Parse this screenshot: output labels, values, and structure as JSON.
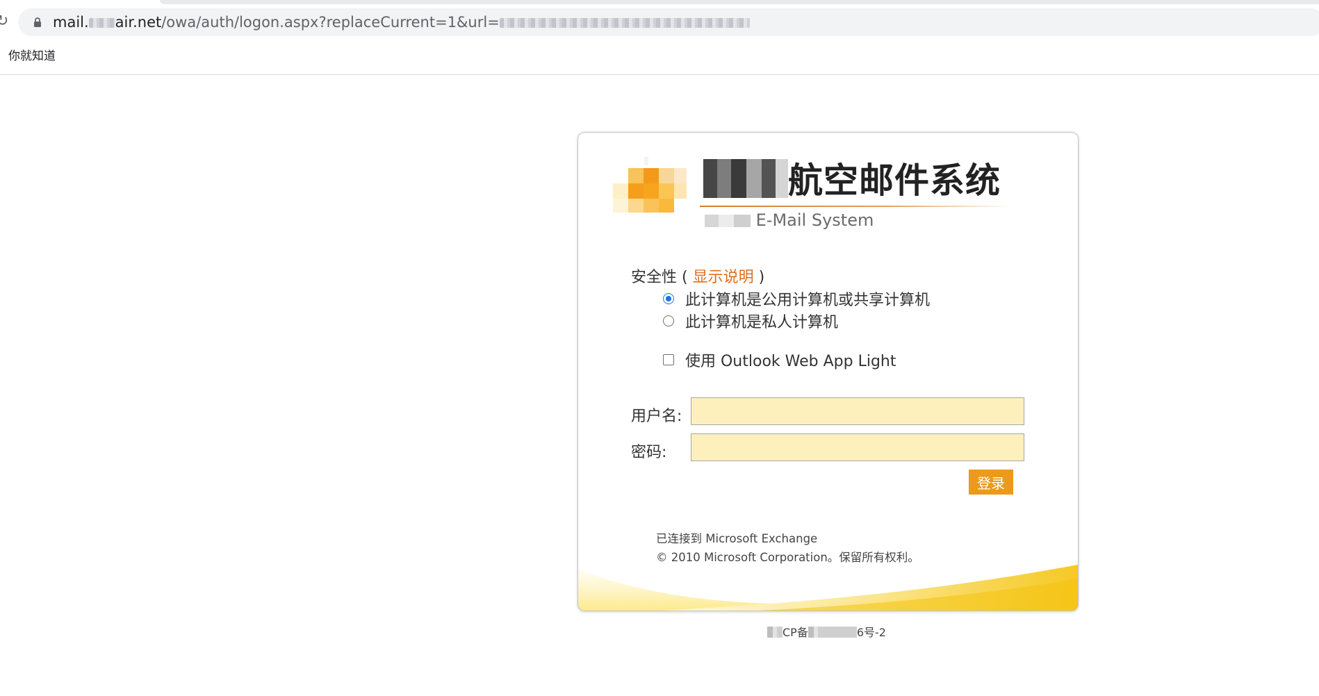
{
  "browser": {
    "url_host_prefix": "mail.",
    "url_host_suffix": "air.net",
    "url_path": "/owa/auth/logon.aspx?replaceCurrent=1&url=",
    "bookmark_label": "你就知道"
  },
  "logo": {
    "title_visible": "航空邮件系统",
    "subtitle": "E-Mail System"
  },
  "security": {
    "label_prefix": "安全性 (",
    "show_help_link": "显示说明",
    "label_suffix": ")"
  },
  "options": {
    "public_computer": "此计算机是公用计算机或共享计算机",
    "private_computer": "此计算机是私人计算机",
    "light_version": "使用 Outlook Web App Light",
    "selected": "public_computer"
  },
  "form": {
    "username_label": "用户名:",
    "password_label": "密码:",
    "username_value": "",
    "password_value": "",
    "login_button": "登录"
  },
  "footer": {
    "connected": "已连接到 Microsoft Exchange",
    "copyright": "© 2010 Microsoft Corporation。保留所有权利。"
  },
  "icp": {
    "prefix": "CP备",
    "suffix": "6号-2"
  },
  "colors": {
    "link_orange": "#e06e1b",
    "button_orange": "#eb9a1c",
    "input_yellow": "#fdf0bc",
    "radio_blue": "#1a73e8"
  }
}
